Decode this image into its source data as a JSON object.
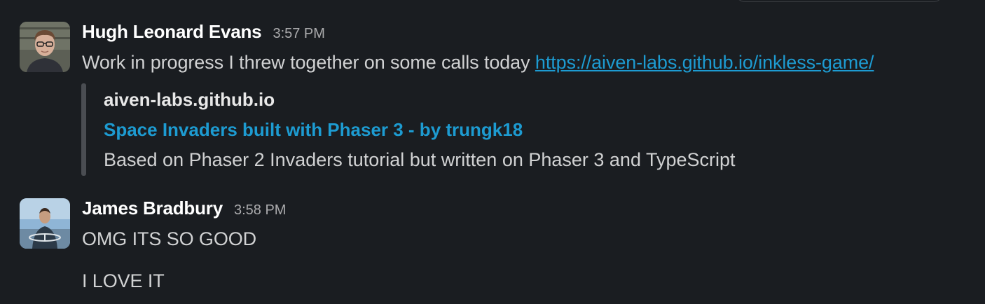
{
  "messages": [
    {
      "sender": "Hugh Leonard Evans",
      "time": "3:57 PM",
      "text": "Work in progress I threw together on some calls today ",
      "link": "https://aiven-labs.github.io/inkless-game/",
      "unfurl": {
        "domain": "aiven-labs.github.io",
        "title": "Space Invaders built with Phaser 3 - by trungk18",
        "description": "Based on Phaser 2 Invaders tutorial but written on Phaser 3 and TypeScript"
      }
    },
    {
      "sender": "James Bradbury",
      "time": "3:58 PM",
      "lines": [
        "OMG ITS SO GOOD",
        "I LOVE IT"
      ]
    }
  ],
  "colors": {
    "background": "#1a1d21",
    "link": "#1d9bd1",
    "text": "#d1d2d3",
    "name": "#ffffff",
    "timestamp": "#ababad"
  }
}
